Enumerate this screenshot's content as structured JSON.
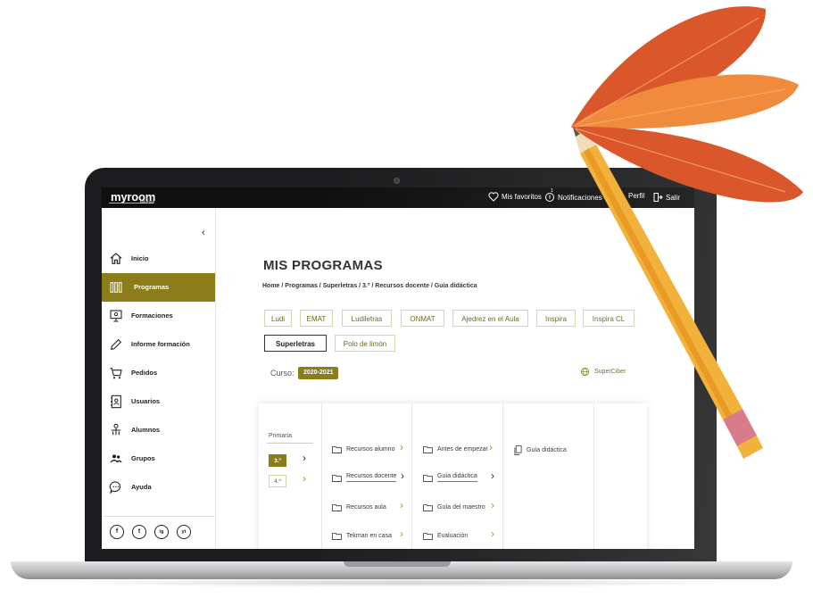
{
  "header": {
    "logo": "myroom",
    "logo_sub": "tekman",
    "favorites": "Mis favoritos",
    "notifications": "Notificaciones",
    "notif_count": "1",
    "profile": "Perfil",
    "logout": "Salir"
  },
  "sidebar": {
    "collapse": "‹",
    "items": [
      {
        "label": "Inicio",
        "icon": "home-icon"
      },
      {
        "label": "Programas",
        "icon": "books-icon",
        "active": true
      },
      {
        "label": "Formaciones",
        "icon": "presentation-icon"
      },
      {
        "label": "Informe formación",
        "icon": "pencil-icon"
      },
      {
        "label": "Pedidos",
        "icon": "cart-icon"
      },
      {
        "label": "Usuarios",
        "icon": "contacts-icon"
      },
      {
        "label": "Alumnos",
        "icon": "student-icon"
      },
      {
        "label": "Grupos",
        "icon": "group-icon"
      },
      {
        "label": "Ayuda",
        "icon": "help-chat-icon"
      }
    ],
    "socials": [
      "f",
      "t",
      "ig",
      "yt"
    ]
  },
  "main": {
    "title": "MIS PROGRAMAS",
    "breadcrumb": "Home  /  Programas  /  Superletras  /  3.º  /  Recursos docente  /  Guía didáctica",
    "programs": [
      "Ludi",
      "EMAT",
      "Ludiletras",
      "ONMAT",
      "Ajedrez en el Aula",
      "Inspira",
      "Inspira CL",
      "Superletras",
      "Polo de limón"
    ],
    "selected_program": "Superletras",
    "curso_label": "Curso:",
    "curso_value": "2020-2021",
    "superciber": "SuperCiber",
    "level": "Primaria",
    "grades": [
      "3.º",
      "4.º"
    ],
    "col1": [
      "Recursos alumno",
      "Recursos docente",
      "Recursos aula",
      "Tekman en casa"
    ],
    "col2": [
      "Antes de empezar",
      "Guía didáctica",
      "Guía del maestro",
      "Evaluación"
    ],
    "col3": [
      "Guía didáctica"
    ]
  },
  "colors": {
    "accent": "#8a7d1a",
    "leaf_dark": "#d9572a",
    "leaf_light": "#f08a3c",
    "pencil": "#f2b13a"
  }
}
